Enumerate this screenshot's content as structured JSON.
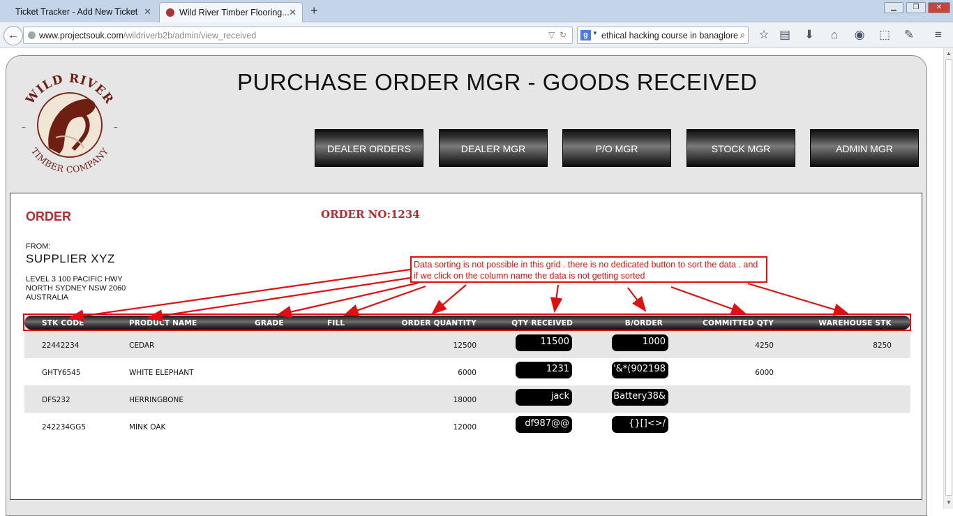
{
  "browser": {
    "tabs": [
      {
        "title": "Ticket Tracker - Add New Ticket",
        "close": "✕"
      },
      {
        "title": "Wild River Timber Flooring...",
        "close": "✕"
      }
    ],
    "new_tab": "+",
    "url_host": "www.projectsouk.com",
    "url_path": "/wildriverb2b/admin/view_received",
    "search_value": "ethical hacking course in banaglore",
    "search_engine_badge": "g"
  },
  "logo": {
    "top_text": "WILD RIVER",
    "bottom_text": "TIMBER COMPANY"
  },
  "page": {
    "title": "PURCHASE ORDER MGR - GOODS RECEIVED"
  },
  "nav": [
    "DEALER ORDERS",
    "DEALER MGR",
    "P/O MGR",
    "STOCK MGR",
    "ADMIN MGR"
  ],
  "order": {
    "heading": "ORDER",
    "order_no": "ORDER NO:1234",
    "from_label": "FROM:",
    "supplier": "SUPPLIER XYZ",
    "address": [
      "LEVEL 3 100 PACIFIC HWY",
      "NORTH SYDNEY NSW 2060",
      "AUSTRALIA"
    ]
  },
  "grid": {
    "columns": [
      "STK CODE",
      "PRODUCT NAME",
      "GRADE",
      "FILL",
      "ORDER QUANTITY",
      "QTY RECEIVED",
      "B/ORDER",
      "COMMITTED QTY",
      "WAREHOUSE STK"
    ],
    "rows": [
      {
        "stk_code": "22442234",
        "product": "CEDAR",
        "grade": "",
        "fill": "",
        "order_qty": "12500",
        "qty_received": "11500",
        "b_order": "1000",
        "committed": "4250",
        "warehouse": "8250"
      },
      {
        "stk_code": "GHTY6545",
        "product": "WHITE ELEPHANT",
        "grade": "",
        "fill": "",
        "order_qty": "6000",
        "qty_received": "1231",
        "b_order": "'&*(902198",
        "committed": "6000",
        "warehouse": ""
      },
      {
        "stk_code": "DFS232",
        "product": "HERRINGBONE",
        "grade": "",
        "fill": "",
        "order_qty": "18000",
        "qty_received": "jack",
        "b_order": "Battery38&",
        "committed": "",
        "warehouse": ""
      },
      {
        "stk_code": "242234GG5",
        "product": "MINK OAK",
        "grade": "",
        "fill": "",
        "order_qty": "12000",
        "qty_received": "df987@@",
        "b_order": "{}[]<>/",
        "committed": "",
        "warehouse": ""
      }
    ]
  },
  "annotation": {
    "text": "Data sorting is not possible in this grid . there is no dedicated button to sort the data . and if we click on the column name the data is not getting sorted",
    "color": "#e01010"
  },
  "colors": {
    "accent_red": "#b52a2a",
    "page_bg": "#e6e6e6",
    "annotation_red": "#e01010"
  }
}
